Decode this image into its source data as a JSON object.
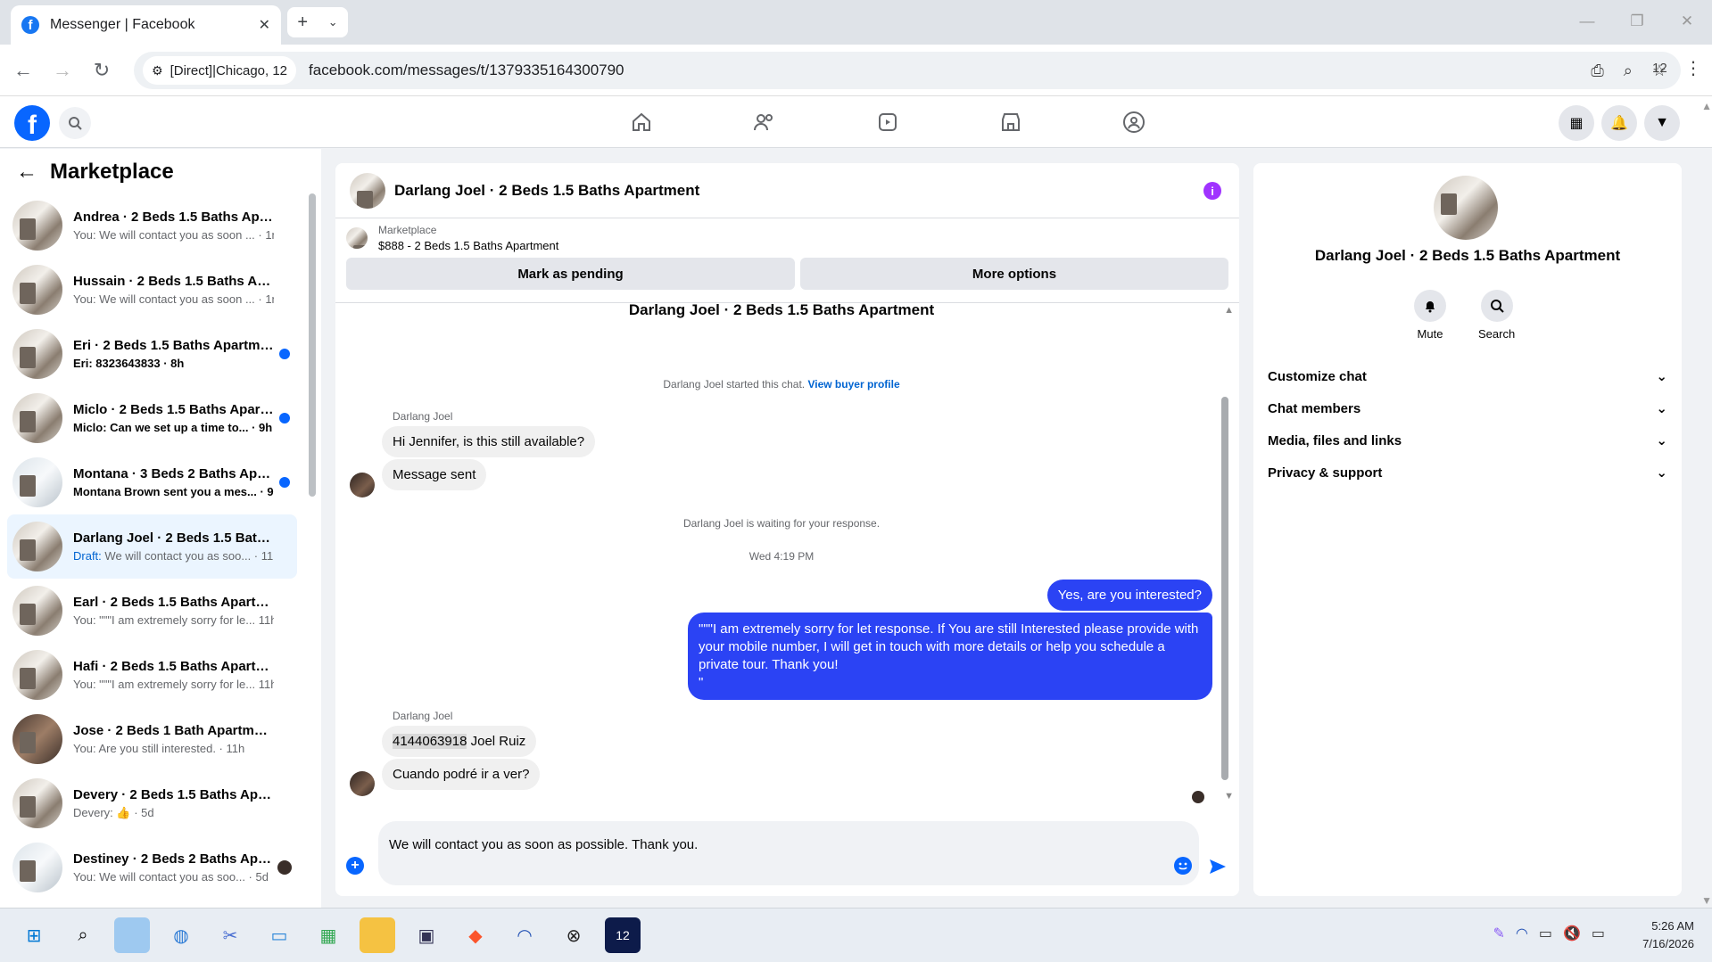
{
  "browser": {
    "tab_title": "Messenger | Facebook",
    "tab_close": "✕",
    "new_tab": "+",
    "site_chip": "[Direct]|Chicago, 12",
    "url": "facebook.com/messages/t/1379335164300790",
    "ext_count": "12"
  },
  "left": {
    "title": "Marketplace",
    "conversations": [
      {
        "name": "Andrea · 2 Beds 1.5 Baths Apart...",
        "preview": "You: We will contact you as soon ... · 1m",
        "unread": false
      },
      {
        "name": "Hussain · 2 Beds 1.5 Baths Apart...",
        "preview": "You: We will contact you as soon ... · 1m",
        "unread": false
      },
      {
        "name": "Eri · 2 Beds 1.5 Baths Apartment",
        "preview": "Eri: 8323643833 · 8h",
        "unread": true
      },
      {
        "name": "Miclo · 2 Beds 1.5 Baths Apart...",
        "preview": "Miclo: Can we set up a time to... · 9h",
        "unread": true
      },
      {
        "name": "Montana · 3 Beds 2 Baths Apa...",
        "preview": "Montana Brown sent you a mes... · 9h",
        "unread": true
      },
      {
        "name": "Darlang Joel · 2 Beds 1.5 Baths ...",
        "draft_label": "Draft:",
        "preview": "We will contact you as soo... · 11h",
        "unread": false
      },
      {
        "name": "Earl · 2 Beds 1.5 Baths Apartment",
        "preview": "You: \"\"\"I am extremely sorry for le... 11h",
        "unread": false
      },
      {
        "name": "Hafi · 2 Beds 1.5 Baths Apartment",
        "preview": "You: \"\"\"I am extremely sorry for le... 11h",
        "unread": false
      },
      {
        "name": "Jose · 2 Beds 1 Bath Apartment",
        "preview": "You: Are you still interested. · 11h",
        "unread": false
      },
      {
        "name": "Devery · 2 Beds 1.5 Baths Apart...",
        "preview": "Devery: 👍 · 5d",
        "unread": false
      },
      {
        "name": "Destiney · 2 Beds 2 Baths Apa...",
        "preview": "You: We will contact you as soo... · 5d",
        "unread": false
      }
    ]
  },
  "chat": {
    "header_name": "Darlang Joel · 2 Beds 1.5 Baths Apartment",
    "marketplace_label": "Marketplace",
    "listing": "$888 - 2 Beds 1.5 Baths Apartment",
    "mark_pending": "Mark as pending",
    "more_options": "More options",
    "thread_title": "Darlang Joel · 2 Beds 1.5 Baths Apartment",
    "started_text": "Darlang Joel started this chat.",
    "view_profile": "View buyer profile",
    "sender1": "Darlang Joel",
    "msg1": "Hi Jennifer, is this still available?",
    "msg2": "Message sent",
    "waiting": "Darlang Joel is waiting for your response.",
    "timestamp": "Wed 4:19 PM",
    "out1": "Yes, are you interested?",
    "out2": "\"\"\"I am extremely sorry for let response. If You are still Interested please provide with your mobile number, I will get in touch with more details or help you schedule a private tour. Thank you!\n\"",
    "sender2": "Darlang Joel",
    "msg3_phone": "4144063918",
    "msg3_rest": " Joel Ruiz",
    "msg4": "Cuando podré ir a ver?",
    "composer_text": "We will contact you as soon as possible. Thank you."
  },
  "right": {
    "name": "Darlang Joel · 2 Beds 1.5 Baths Apartment",
    "mute": "Mute",
    "search": "Search",
    "sections": [
      "Customize chat",
      "Chat members",
      "Media, files and links",
      "Privacy & support"
    ]
  },
  "taskbar": {
    "time": "5:26 AM",
    "date": "7/16/2026"
  }
}
